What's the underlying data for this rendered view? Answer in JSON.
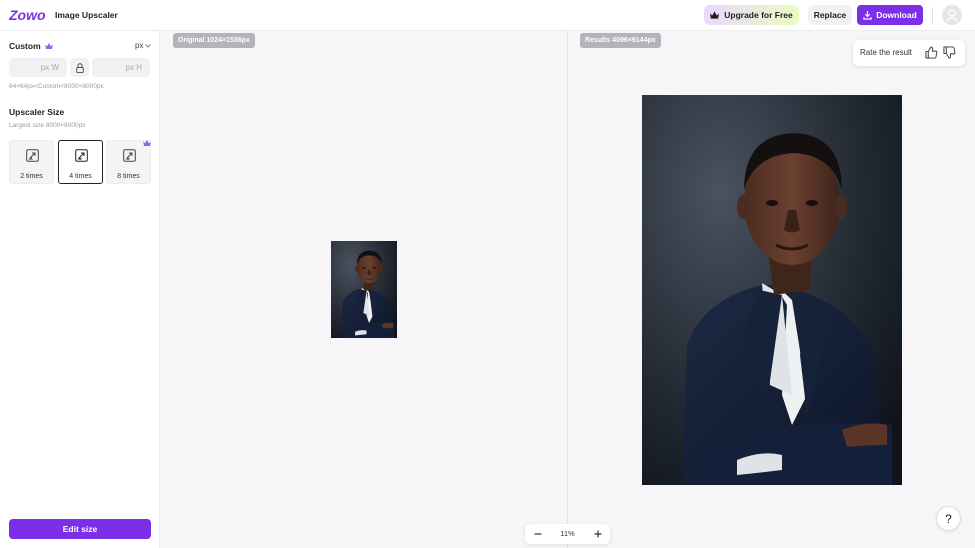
{
  "header": {
    "logo_text": "Zowo",
    "app_title": "Image Upscaler",
    "upgrade_label": "Upgrade for Free",
    "replace_label": "Replace",
    "download_label": "Download",
    "accent_color": "#7b2fe6",
    "icons": [
      "crown-icon",
      "download-icon",
      "user-avatar-icon"
    ]
  },
  "sidebar": {
    "custom_label": "Custom",
    "unit": "px",
    "width_placeholder": "px W",
    "height_placeholder": "px H",
    "range_hint": "64×64px<Custom<8000×8000px",
    "upscaler_label": "Upscaler Size",
    "largest_hint": "Largest size 8000×8000px",
    "options": [
      {
        "label": "2 times",
        "selected": false,
        "premium": false
      },
      {
        "label": "4 times",
        "selected": true,
        "premium": false
      },
      {
        "label": "8 times",
        "selected": false,
        "premium": true
      }
    ],
    "edit_button": "Edit size"
  },
  "canvas": {
    "original_tag": "Original 1024×1536px",
    "result_tag": "Results 4096×6144px",
    "rate_label": "Rate the result",
    "zoom_value": "11%",
    "help_label": "?"
  }
}
